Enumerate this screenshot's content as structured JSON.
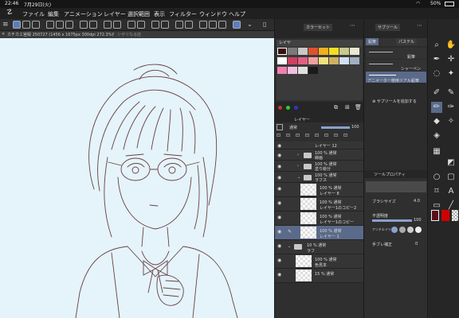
{
  "status": {
    "time": "22:46",
    "date": "7月29日(火)",
    "battery": "50%"
  },
  "menu": [
    "ファイル",
    "編集",
    "アニメーション",
    "レイヤー",
    "選択範囲",
    "表示",
    "フィルター",
    "ウィンドウ",
    "ヘルプ"
  ],
  "canvas": {
    "tab_title": "カチカエ宮殿 250727 (1456 x 1675px 300dpi 272.3%)",
    "tab2_title": "シザリなる店"
  },
  "color_set": {
    "tab": "カラーセット",
    "dropdown": "レイヤ"
  },
  "swatches": [
    "#3a0e0e",
    "#7a7a7a",
    "#c8c8c8",
    "#e05030",
    "#f0b020",
    "#f0e020",
    "#c8c890",
    "#e8e8d0",
    "#ffffff",
    "#d04060",
    "#e06080",
    "#f0a0a0",
    "#f0e080",
    "#d0b060",
    "#d0e0f0",
    "#a0b0c0",
    "#f080b0",
    "#f0c0e0",
    "#e0e0e0",
    "#1a1a1a"
  ],
  "subtool": {
    "tab": "サブツール",
    "tab1": "鉛筆",
    "tab2": "パステル",
    "item1": "鉛筆",
    "item2": "シャーペン",
    "item3": "アニメーター使用リアル鉛筆",
    "add_label": "サブツールを追加する"
  },
  "layer_panel": {
    "title": "レイヤー",
    "blend": "通常",
    "opacity": "100",
    "rows": [
      {
        "l1": "レイヤー 12",
        "l2": ""
      },
      {
        "l1": "100 % 通常",
        "l2": "線画"
      },
      {
        "l1": "100 % 通常",
        "l2": "塗り絵分"
      },
      {
        "l1": "100 % 通常",
        "l2": "ラフス"
      },
      {
        "l1": "100 % 通常",
        "l2": "レイヤー 8"
      },
      {
        "l1": "100 % 通常",
        "l2": "レイヤー1のコピー2"
      },
      {
        "l1": "100 % 通常",
        "l2": "レイヤー1のコピー"
      },
      {
        "l1": "100 % 通常",
        "l2": "レイヤー 1"
      },
      {
        "l1": "10 % 通常",
        "l2": "ラフ"
      },
      {
        "l1": "100 % 通常",
        "l2": "色見本"
      },
      {
        "l1": "15 % 通常",
        "l2": ""
      }
    ]
  },
  "tool_property": {
    "tab": "ツールプロパティ",
    "brush_size_label": "ブラシサイズ",
    "brush_size_value": "4.0",
    "opacity_label": "不透明度",
    "opacity_value": "100",
    "antialias_label": "アンチエイリアス",
    "stabilization_label": "手ブレ補正",
    "stabilization_value": "0"
  },
  "colors": {
    "accent": "#5a7fbf",
    "primary": "#d00000",
    "canvas_bg": "#e4f4fa"
  },
  "tools": [
    "magnifier-icon",
    "hand-icon",
    "eyedropper-icon",
    "move-icon",
    "lasso-icon",
    "wand-icon",
    "pen-icon",
    "pencil-icon",
    "brush-icon",
    "airbrush-icon",
    "eraser-icon",
    "blend-icon",
    "fill-icon",
    "gradient-icon",
    "shape-icon",
    "text-icon",
    "balloon-icon",
    "ruler-icon"
  ]
}
